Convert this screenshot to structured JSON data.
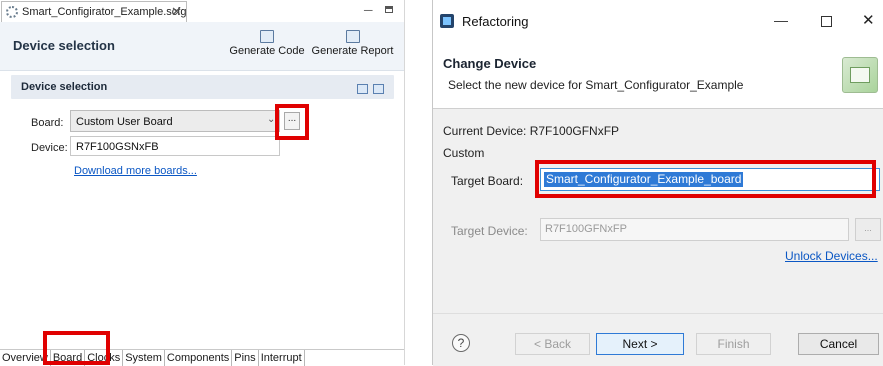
{
  "editor": {
    "tab_title": "Smart_Configirator_Example.scfg",
    "tab_close": "✕",
    "page_title": "Device selection",
    "toolbar": {
      "generate_code": "Generate Code",
      "generate_report": "Generate Report"
    },
    "section_title": "Device selection",
    "board_label": "Board:",
    "board_value": "Custom User Board",
    "browse_label": "...",
    "device_label": "Device:",
    "device_value": "R7F100GSNxFB",
    "download_link": "Download more boards...",
    "bottom_tabs": [
      "Overview",
      "Board",
      "Clocks",
      "System",
      "Components",
      "Pins",
      "Interrupt"
    ],
    "active_tab": "Board"
  },
  "dialog": {
    "window_title": "Refactoring",
    "heading": "Change Device",
    "description": "Select the new device for Smart_Configurator_Example",
    "current_device": "Current Device: R7F100GFNxFP",
    "custom_label": "Custom",
    "target_board_label": "Target Board:",
    "target_board_value": "Smart_Configurator_Example_board",
    "target_device_label": "Target Device:",
    "target_device_value": "R7F100GFNxFP",
    "target_device_browse": "...",
    "unlock_link": "Unlock Devices...",
    "help": "?",
    "buttons": {
      "back": "< Back",
      "next": "Next >",
      "finish": "Finish",
      "cancel": "Cancel"
    },
    "window_controls": {
      "minimize": "—",
      "close": "✕"
    }
  },
  "colors": {
    "highlight_box": "#e00000",
    "link": "#0b57c4",
    "selection": "#2f7ad6"
  }
}
